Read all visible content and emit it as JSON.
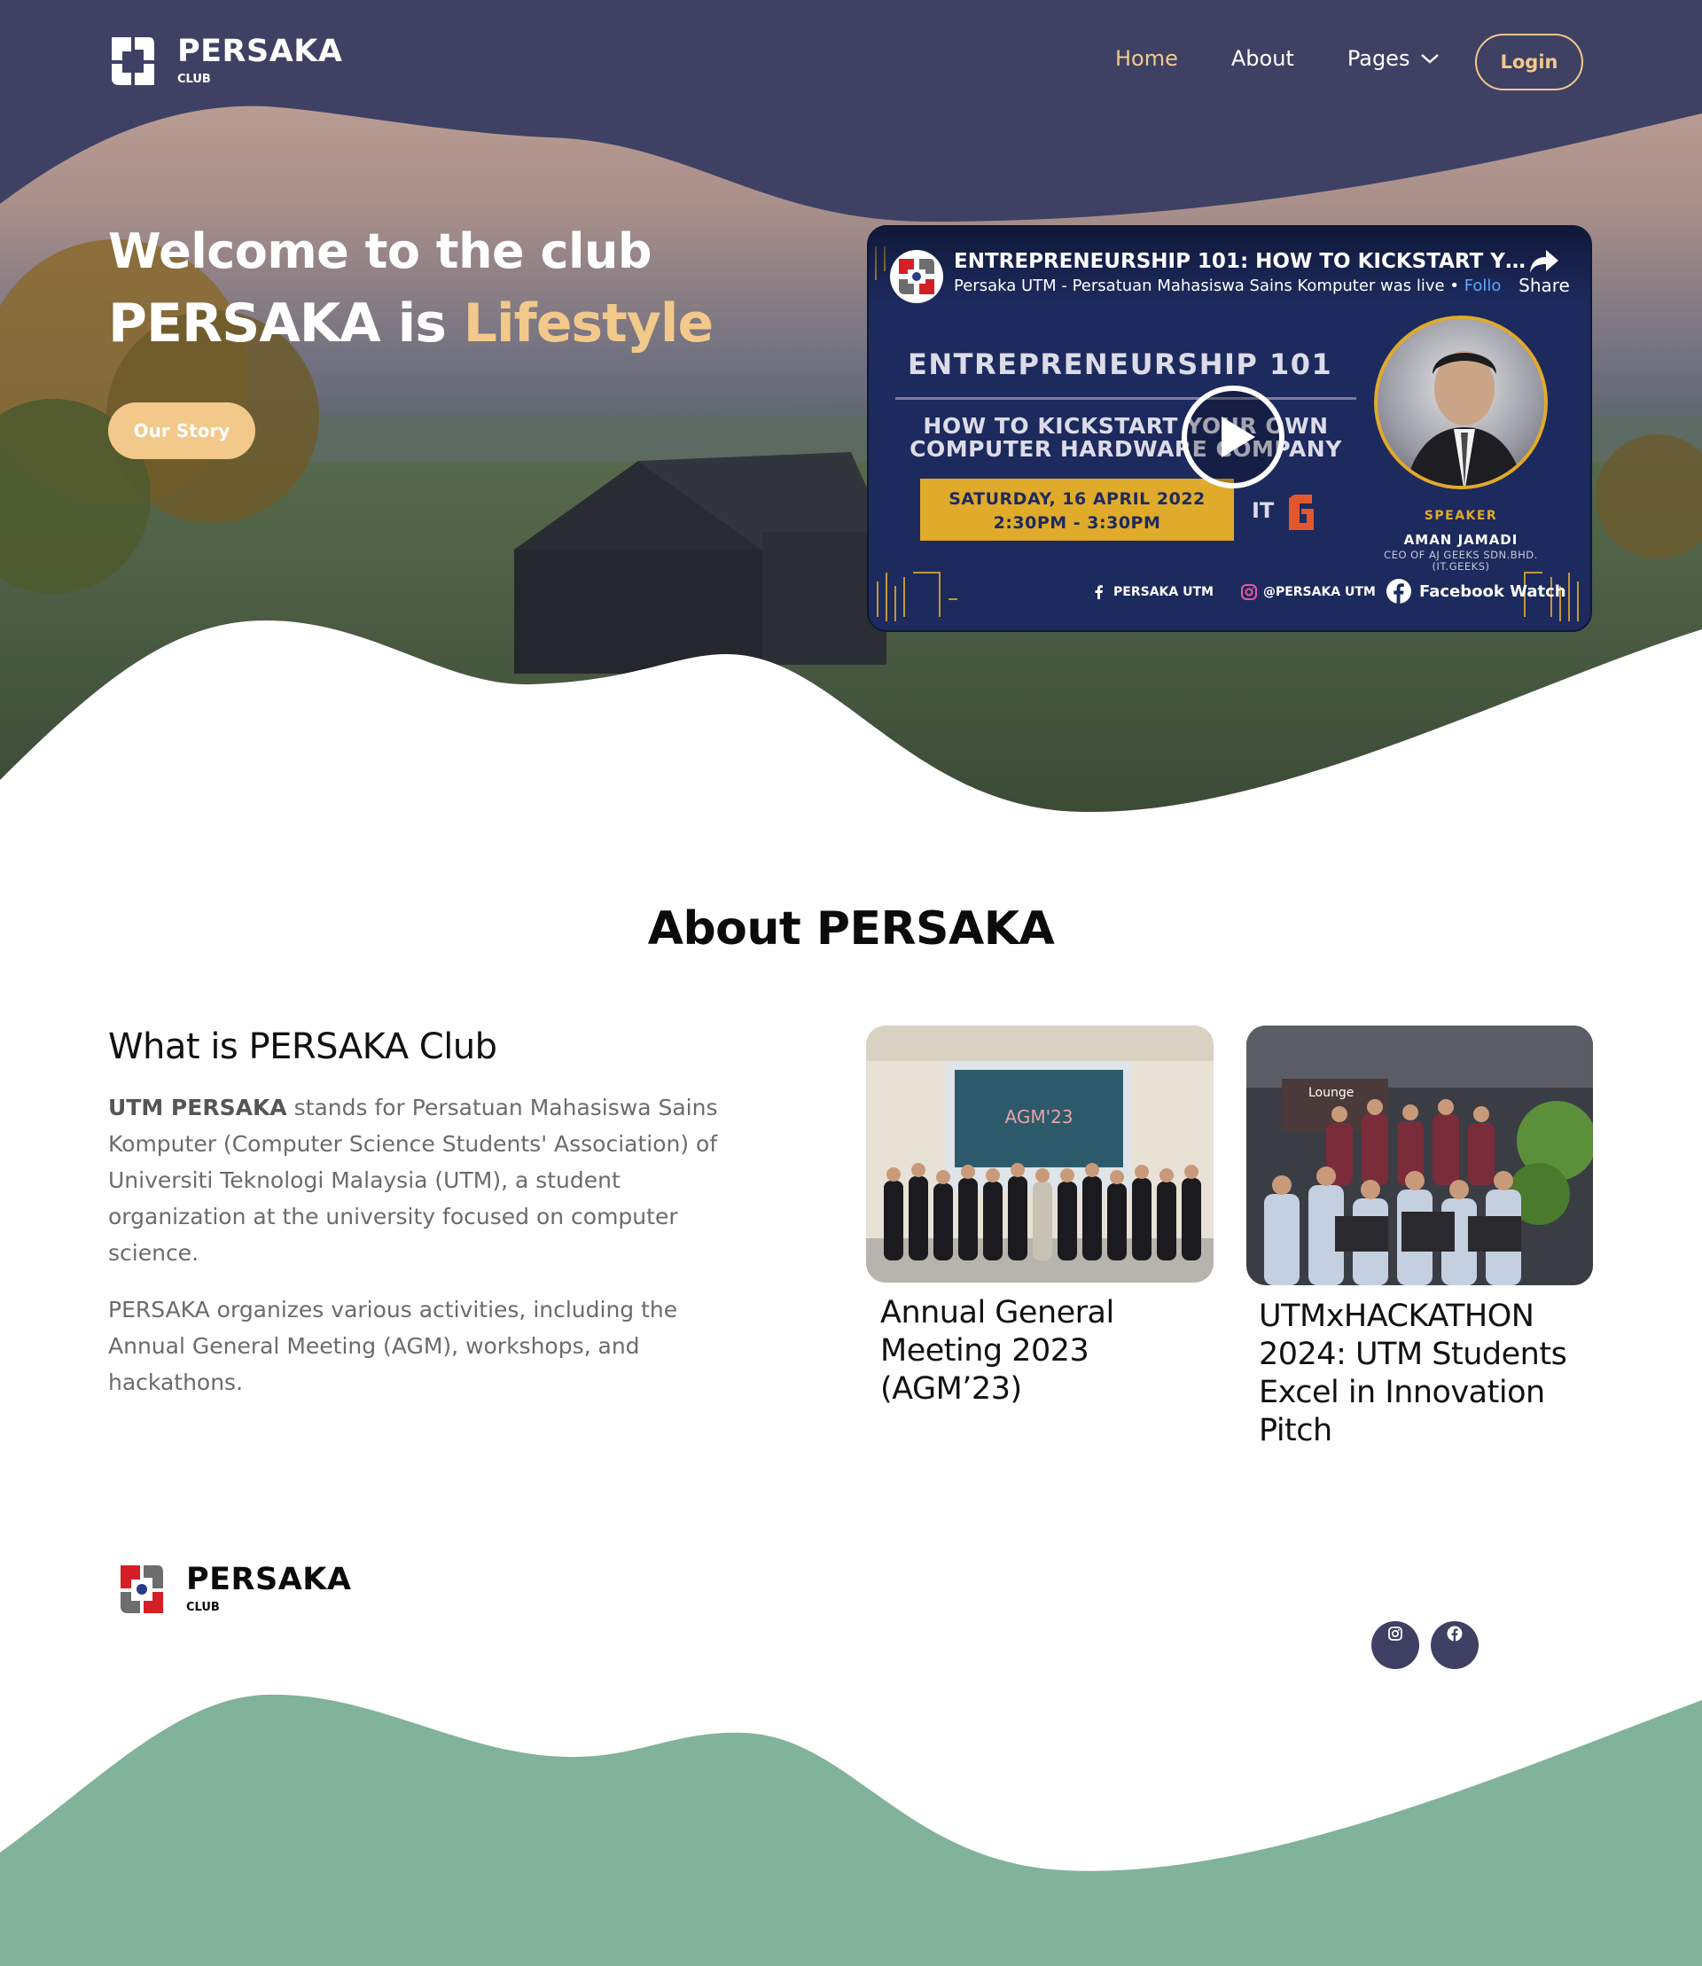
{
  "brand": {
    "name": "PERSAKA",
    "sub": "CLUB"
  },
  "nav": {
    "items": [
      {
        "label": "Home",
        "active": true
      },
      {
        "label": "About",
        "active": false
      },
      {
        "label": "Pages",
        "active": false
      }
    ],
    "login_label": "Login"
  },
  "hero": {
    "title_line1": "Welcome to the club",
    "title_line2_prefix": "PERSAKA is ",
    "title_line2_accent": "Lifestyle",
    "cta_label": "Our Story"
  },
  "video": {
    "title": "ENTREPRENEURSHIP 101: HOW TO KICKSTART Y…",
    "subtitle": "Persaka UTM - Persatuan Mahasiswa Sains Komputer was live • ",
    "follow": "Follo",
    "share_label": "Share",
    "headline": "ENTREPRENEURSHIP 101",
    "subhead_line1": "HOW TO KICKSTART YOUR OWN",
    "subhead_line2": "COMPUTER HARDWARE COMPANY",
    "date": "SATURDAY, 16 APRIL 2022",
    "time": "2:30PM - 3:30PM",
    "speaker_label": "SPEAKER",
    "speaker_name": "AMAN JAMADI",
    "speaker_role_line1": "CEO OF AJ GEEKS SDN.BHD.",
    "speaker_role_line2": "(IT.GEEKS)",
    "social_fb": "PERSAKA UTM",
    "social_ig": "@PERSAKA UTM",
    "fb_watch": "Facebook Watch"
  },
  "about": {
    "title": "About PERSAKA",
    "heading": "What is PERSAKA Club",
    "p1_bold": "UTM PERSAKA",
    "p1_rest": " stands for Persatuan Mahasiswa Sains Komputer (Computer Science Students' Association) of Universiti Teknologi Malaysia (UTM), a student organization at the university focused on computer science.",
    "p2": "PERSAKA organizes various activities, including the Annual General Meeting (AGM), workshops, and hackathons.",
    "cards": [
      {
        "caption": "Annual General Meeting 2023 (AGM’23)",
        "image_text": "AGM'23"
      },
      {
        "caption": "UTMxHACKATHON 2024: UTM Students Excel in Innovation Pitch",
        "image_text": "Lounge"
      }
    ]
  },
  "footer": {
    "brand_name": "PERSAKA",
    "brand_sub": "CLUB",
    "social": [
      {
        "icon": "instagram-icon"
      },
      {
        "icon": "facebook-icon"
      }
    ]
  },
  "colors": {
    "navy": "#3e4163",
    "accent": "#f2c98b",
    "green": "#81b29a",
    "text_gray": "#6b6b6b"
  }
}
